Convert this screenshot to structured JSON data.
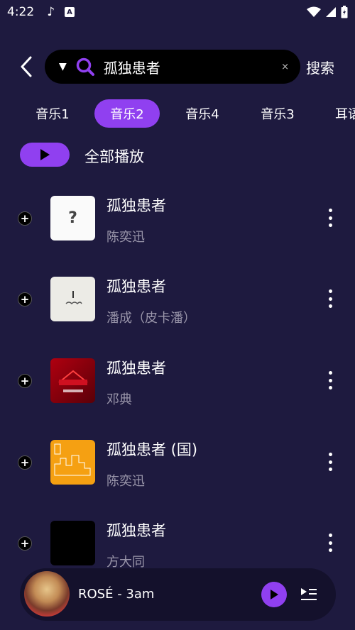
{
  "status": {
    "time": "4:22",
    "badge": "A"
  },
  "header": {
    "query": "孤独患者",
    "clear": "×",
    "search_label": "搜索"
  },
  "tabs": [
    {
      "label": "音乐1"
    },
    {
      "label": "音乐2"
    },
    {
      "label": "音乐4"
    },
    {
      "label": "音乐3"
    },
    {
      "label": "耳语"
    }
  ],
  "play_all": {
    "label": "全部播放"
  },
  "songs": [
    {
      "title": "孤独患者",
      "artist": "陈奕迅"
    },
    {
      "title": "孤独患者",
      "artist": "潘成（皮卡潘）"
    },
    {
      "title": "孤独患者",
      "artist": "邓典"
    },
    {
      "title": "孤独患者 (国)",
      "artist": "陈奕迅"
    },
    {
      "title": "孤独患者",
      "artist": "方大同"
    }
  ],
  "player": {
    "title": "ROSÉ - 3am"
  },
  "colors": {
    "background": "#1e1a3f",
    "accent": "#9040f0",
    "search_bg": "#000000",
    "secondary_text": "#9a96aa"
  }
}
